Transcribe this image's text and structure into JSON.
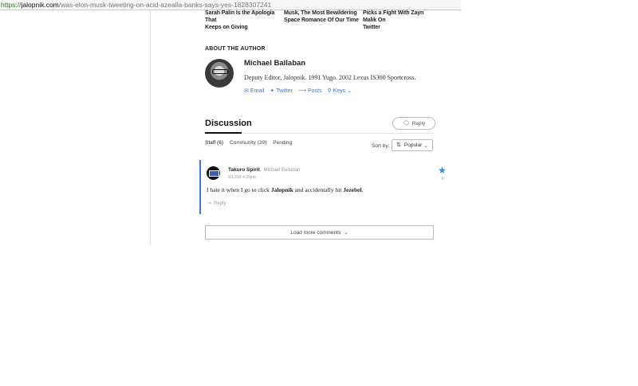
{
  "browser": {
    "url_scheme": "https://",
    "url_domain": "jalopnik.com",
    "url_path": "/was-elon-musk-tweeting-on-acid-azealia-banks-says-yes-1828307241"
  },
  "related": [
    {
      "line1": "Sarah Palin Is the Apologia That",
      "line2": "Keeps on Giving"
    },
    {
      "line1": "Musk, The Most Bewildering",
      "line2": "Space Romance Of Our Time"
    },
    {
      "line1": "Picks a Fight With Zayn Malik On",
      "line2": "Twitter"
    }
  ],
  "author": {
    "section_heading": "ABOUT THE AUTHOR",
    "name": "Michael Ballaban",
    "bio": "Deputy Editor, Jalopnik. 1991 Yugo. 2002 Lexus IS300 Sportcross.",
    "links": {
      "email": "Email",
      "twitter": "Twitter",
      "posts": "Posts",
      "keys": "Keys"
    }
  },
  "discussion": {
    "title": "Discussion",
    "reply_label": "Reply",
    "tabs": [
      "Staff (6)",
      "Community (39)",
      "Pending"
    ],
    "sort_label": "Sort by:",
    "sort_value": "Popular",
    "load_more": "Load more comments"
  },
  "comment": {
    "author": "Takuro Spirit",
    "reply_to": "Michael Ballaban",
    "time": "6/13/18 4:25pm",
    "star_count": "6",
    "text_1": "I hate it when I go to click ",
    "text_bold_1": "Jalopnik",
    "text_2": " and accidentally hit ",
    "text_bold_2": "Jezebel",
    "text_3": ".",
    "reply_label": "Reply"
  },
  "colors": {
    "accent": "#3a7bd5",
    "star": "#2a8be0"
  }
}
